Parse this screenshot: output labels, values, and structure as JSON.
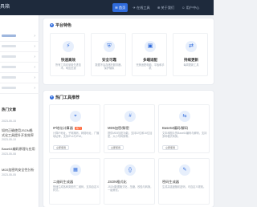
{
  "app": {
    "brand": "工具箱"
  },
  "nav": {
    "items": [
      {
        "label": "☰ 首页",
        "active": true
      },
      {
        "label": "✈ 在线工具",
        "active": false
      },
      {
        "label": "⊕ 关于我们",
        "active": false
      },
      {
        "label": "☺ 用户中心",
        "active": false
      }
    ]
  },
  "sidebar": {
    "items": [
      {
        "chevron": "›",
        "active": true
      },
      {
        "chevron": "›",
        "active": false
      },
      {
        "chevron": "›",
        "active": false
      },
      {
        "chevron": "›",
        "active": false
      },
      {
        "chevron": "›",
        "active": false
      },
      {
        "chevron": "›",
        "active": false
      }
    ],
    "articles_title": "热门文章",
    "articles": [
      {
        "title": "",
        "date": "2023-05-15"
      },
      {
        "title": "如何正确使用JSON格式化工具提升开发效率",
        "date": "2023-05-10"
      },
      {
        "title": "Base64编码原理与应用",
        "date": "2023-05-08"
      },
      {
        "title": "MD5加密的安全性分析",
        "date": "2023-05-05"
      }
    ]
  },
  "features": {
    "title": "平台特色",
    "items": [
      {
        "icon": "⚡",
        "title": "快速高效",
        "desc": "所有工具均采用先进技术，响应迅速"
      },
      {
        "icon": "⛨",
        "title": "安全可靠",
        "desc": "数据不会存储在服务器，保护隐私"
      },
      {
        "icon": "▣",
        "title": "多端适配",
        "desc": "完美适配电脑、平板和手机"
      },
      {
        "icon": "⇄",
        "title": "持续更新",
        "desc": "每周更新工具"
      }
    ]
  },
  "tools": {
    "title": "热门工具推荐",
    "items": [
      {
        "icon": "⌖",
        "name": "IP地址计算器",
        "badge": "热门",
        "desc": "计算IP地址，子网掩码，网络地址，广播地址等，支持IPv4与IPv6。",
        "button": "立即使用"
      },
      {
        "icon": "#",
        "name": "MD5加密/解密",
        "badge": "",
        "desc": "提供MD5加密功能，支持32位和16位加密，大小写转换等。",
        "button": "立即使用"
      },
      {
        "icon": "⇆",
        "name": "Base64编码/解码",
        "badge": "",
        "desc": "文本和图片的Base64编码与解码，支持多种格式转换。",
        "button": "立即使用"
      },
      {
        "icon": "▦",
        "name": "二维码生成器",
        "badge": "",
        "desc": "快速生成各种类型的二维码，支持自定义样式。",
        "button": ""
      },
      {
        "icon": "{}",
        "name": "JSON格式化",
        "badge": "",
        "desc": "JSON数据格式化，压缩，校验与转换，一键美化。",
        "button": ""
      },
      {
        "icon": "✎",
        "name": "密码生成器",
        "badge": "",
        "desc": "生成高强度随机密码，可自定义规则。",
        "button": ""
      }
    ]
  },
  "colors": {
    "accent": "#2f6bdc",
    "topbar": "#1e2a3c",
    "badge": "#ff6a3d"
  }
}
